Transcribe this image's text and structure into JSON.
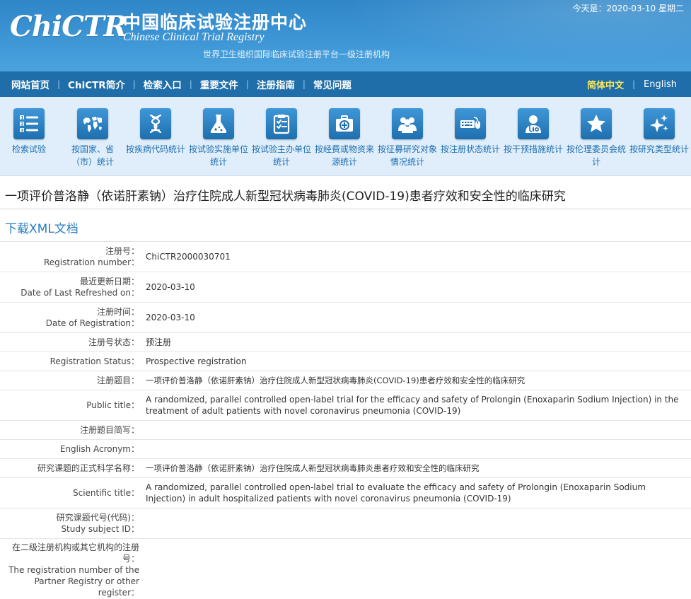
{
  "header": {
    "logo_text": "ChiCTR",
    "title_cn": "中国临床试验注册中心",
    "title_en": "Chinese Clinical Trial Registry",
    "subtitle": "世界卫生组织国际临床试验注册平台一级注册机构",
    "today": "今天是：2020-03-10 星期二"
  },
  "nav": {
    "items": [
      "网站首页",
      "ChiCTR简介",
      "检索入口",
      "重要文件",
      "注册指南",
      "常见问题"
    ],
    "lang_cn": "简体中文",
    "lang_en": "English"
  },
  "iconbar": {
    "items": [
      {
        "label": "检索试验",
        "icon": "list-numbered-icon"
      },
      {
        "label": "按国家、省（市）统计",
        "icon": "world-map-icon"
      },
      {
        "label": "按疾病代码统计",
        "icon": "dna-icon"
      },
      {
        "label": "按试验实施单位统计",
        "icon": "flask-icon"
      },
      {
        "label": "按试验主办单位统计",
        "icon": "clipboard-icon"
      },
      {
        "label": "按经费或物资来源统计",
        "icon": "medical-kit-icon"
      },
      {
        "label": "按征募研究对象情况统计",
        "icon": "people-icon"
      },
      {
        "label": "按注册状态统计",
        "icon": "keyboard-mouse-icon"
      },
      {
        "label": "按干预措施统计",
        "icon": "doctor-icon"
      },
      {
        "label": "按伦理委员会统计",
        "icon": "star-icon"
      },
      {
        "label": "按研究类型统计",
        "icon": "sparkle-icon"
      }
    ]
  },
  "page": {
    "title": "一项评价普洛静（依诺肝素钠）治疗住院成人新型冠状病毒肺炎(COVID-19)患者疗效和安全性的临床研究",
    "download_xml": "下载XML文档"
  },
  "detail": {
    "rows": [
      {
        "label_cn": "注册号：",
        "label_en": "Registration number：",
        "value": "ChiCTR2000030701"
      },
      {
        "label_cn": "最近更新日期：",
        "label_en": "Date of Last Refreshed on：",
        "value": "2020-03-10"
      },
      {
        "label_cn": "注册时间：",
        "label_en": "Date of Registration：",
        "value": "2020-03-10"
      },
      {
        "label_cn": "注册号状态：",
        "label_en": "",
        "value": "预注册"
      },
      {
        "label_cn": "Registration Status：",
        "label_en": "",
        "value": "Prospective registration"
      },
      {
        "label_cn": "注册题目：",
        "label_en": "",
        "value": "一项评价普洛静（依诺肝素钠）治疗住院成人新型冠状病毒肺炎(COVID-19)患者疗效和安全性的临床研究"
      },
      {
        "label_cn": "Public title：",
        "label_en": "",
        "value": "A randomized, parallel controlled open-label trial for the efficacy and safety of Prolongin (Enoxaparin Sodium Injection) in the treatment of adult patients with novel coronavirus pneumonia (COVID-19)"
      },
      {
        "label_cn": "注册题目简写：",
        "label_en": "",
        "value": ""
      },
      {
        "label_cn": "English Acronym：",
        "label_en": "",
        "value": ""
      },
      {
        "label_cn": "研究课题的正式科学名称：",
        "label_en": "",
        "value": "一项评价普洛静（依诺肝素钠）治疗住院成人新型冠状病毒肺炎患者疗效和安全性的临床研究"
      },
      {
        "label_cn": "Scientific title：",
        "label_en": "",
        "value": "A randomized, parallel controlled open-label trial to evaluate the efficacy and safety of Prolongin (Enoxaparin Sodium Injection) in adult hospitalized patients with novel coronavirus pneumonia (COVID-19)"
      },
      {
        "label_cn": "研究课题代号(代码)：",
        "label_en": "Study subject ID：",
        "value": ""
      },
      {
        "label_cn": "在二级注册机构或其它机构的注册号：",
        "label_en": "The registration number of the Partner Registry or other register：",
        "value": ""
      }
    ]
  }
}
